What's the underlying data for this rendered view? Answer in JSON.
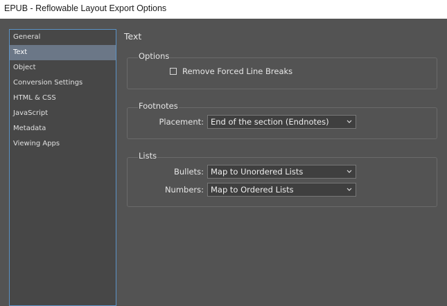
{
  "window": {
    "title": "EPUB - Reflowable Layout Export Options"
  },
  "sidebar": {
    "items": [
      {
        "label": "General",
        "selected": false
      },
      {
        "label": "Text",
        "selected": true
      },
      {
        "label": "Object",
        "selected": false
      },
      {
        "label": "Conversion Settings",
        "selected": false
      },
      {
        "label": "HTML & CSS",
        "selected": false
      },
      {
        "label": "JavaScript",
        "selected": false
      },
      {
        "label": "Metadata",
        "selected": false
      },
      {
        "label": "Viewing Apps",
        "selected": false
      }
    ]
  },
  "main": {
    "heading": "Text",
    "options": {
      "title": "Options",
      "remove_forced_line_breaks": {
        "label": "Remove Forced Line Breaks",
        "checked": false
      }
    },
    "footnotes": {
      "title": "Footnotes",
      "placement": {
        "label": "Placement:",
        "value": "End of the section (Endnotes)"
      }
    },
    "lists": {
      "title": "Lists",
      "bullets": {
        "label": "Bullets:",
        "value": "Map to Unordered Lists"
      },
      "numbers": {
        "label": "Numbers:",
        "value": "Map to Ordered Lists"
      }
    }
  },
  "colors": {
    "background": "#535353",
    "sidebar_selected": "#6b7787",
    "sidebar_border": "#5b93c7"
  }
}
